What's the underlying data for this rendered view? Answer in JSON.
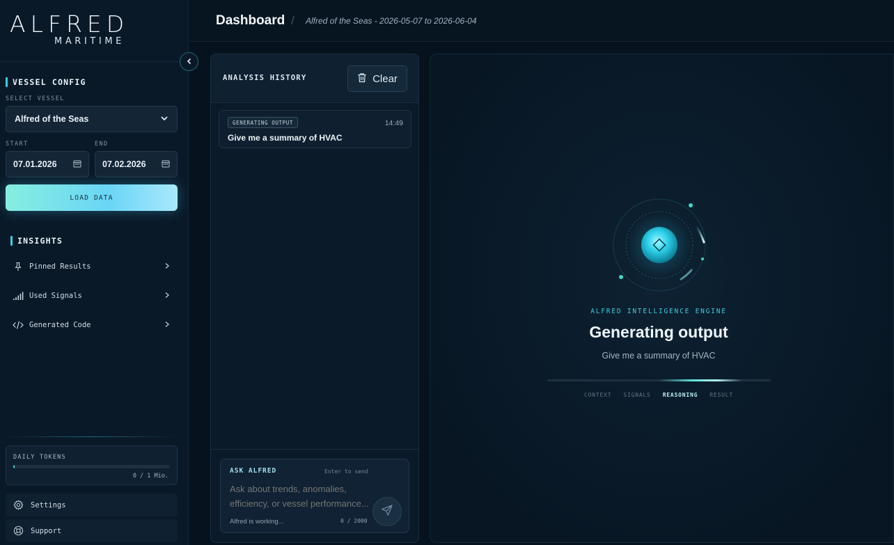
{
  "brand": {
    "name": "ALFRED",
    "sub": "MARITIME"
  },
  "sidebar": {
    "vessel_config": {
      "title": "VESSEL CONFIG",
      "select_label": "SELECT VESSEL",
      "selected_vessel": "Alfred of the Seas",
      "start_label": "START",
      "end_label": "END",
      "start_date": "07.01.2026",
      "end_date": "07.02.2026",
      "load_button": "LOAD DATA"
    },
    "insights": {
      "title": "INSIGHTS",
      "items": [
        {
          "label": "Pinned Results",
          "icon": "pin-icon"
        },
        {
          "label": "Used Signals",
          "icon": "signal-bars-icon"
        },
        {
          "label": "Generated Code",
          "icon": "code-icon"
        }
      ]
    },
    "tokens": {
      "label": "DAILY TOKENS",
      "count": "0 / 1 Mio.",
      "fill_fraction": 0.005
    },
    "settings_label": "Settings",
    "support_label": "Support"
  },
  "header": {
    "title": "Dashboard",
    "separator": "/",
    "breadcrumb": "Alfred of the Seas - 2026-05-07 to 2026-06-04"
  },
  "history": {
    "title": "ANALYSIS HISTORY",
    "clear_label": "Clear",
    "items": [
      {
        "status": "GENERATING OUTPUT",
        "time": "14:49",
        "text": "Give me a summary of HVAC"
      }
    ]
  },
  "ask": {
    "label": "ASK ALFRED",
    "hint": "Enter to send",
    "placeholder": "Ask about trends, anomalies, efficiency, or vessel performance...",
    "status": "Alfred is working...",
    "count": "0 / 2000"
  },
  "output": {
    "engine_label": "ALFRED INTELLIGENCE ENGINE",
    "title": "Generating output",
    "subtitle": "Give me a summary of HVAC",
    "steps": [
      "CONTEXT",
      "SIGNALS",
      "REASONING",
      "RESULT"
    ],
    "active_step": "REASONING"
  },
  "colors": {
    "accent": "#2bd6ea",
    "button_gradient_start": "#86eedf",
    "button_gradient_end": "#6ad5f6"
  }
}
